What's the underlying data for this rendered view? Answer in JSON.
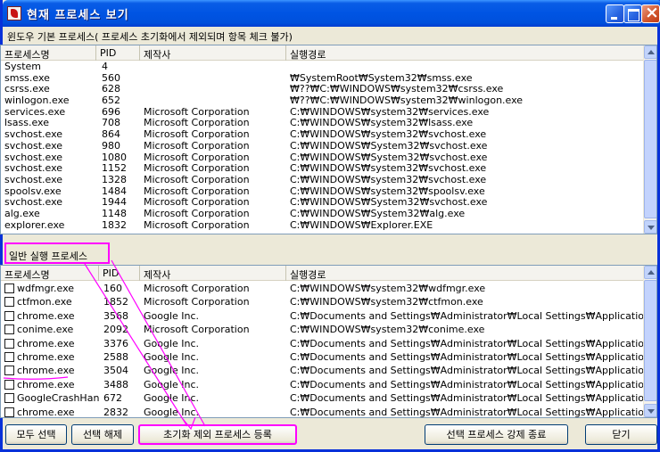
{
  "window": {
    "title": "현재 프로세스 보기"
  },
  "system_section": {
    "label": "윈도우 기본 프로세스( 프로세스 초기화에서 제외되며 항목 체크 불가)",
    "columns": [
      "프로세스명",
      "PID",
      "제작사",
      "실행경로"
    ],
    "rows": [
      [
        "System",
        "4",
        "",
        ""
      ],
      [
        "smss.exe",
        "560",
        "",
        "₩SystemRoot₩System32₩smss.exe"
      ],
      [
        "csrss.exe",
        "628",
        "",
        "₩??₩C:₩WINDOWS₩system32₩csrss.exe"
      ],
      [
        "winlogon.exe",
        "652",
        "",
        "₩??₩C:₩WINDOWS₩system32₩winlogon.exe"
      ],
      [
        "services.exe",
        "696",
        "Microsoft Corporation",
        "C:₩WINDOWS₩system32₩services.exe"
      ],
      [
        "lsass.exe",
        "708",
        "Microsoft Corporation",
        "C:₩WINDOWS₩system32₩lsass.exe"
      ],
      [
        "svchost.exe",
        "864",
        "Microsoft Corporation",
        "C:₩WINDOWS₩system32₩svchost.exe"
      ],
      [
        "svchost.exe",
        "980",
        "Microsoft Corporation",
        "C:₩WINDOWS₩System32₩svchost.exe"
      ],
      [
        "svchost.exe",
        "1080",
        "Microsoft Corporation",
        "C:₩WINDOWS₩System32₩svchost.exe"
      ],
      [
        "svchost.exe",
        "1152",
        "Microsoft Corporation",
        "C:₩WINDOWS₩system32₩svchost.exe"
      ],
      [
        "svchost.exe",
        "1328",
        "Microsoft Corporation",
        "C:₩WINDOWS₩system32₩svchost.exe"
      ],
      [
        "spoolsv.exe",
        "1484",
        "Microsoft Corporation",
        "C:₩WINDOWS₩system32₩spoolsv.exe"
      ],
      [
        "svchost.exe",
        "1944",
        "Microsoft Corporation",
        "C:₩WINDOWS₩System32₩svchost.exe"
      ],
      [
        "alg.exe",
        "1148",
        "Microsoft Corporation",
        "C:₩WINDOWS₩System32₩alg.exe"
      ],
      [
        "explorer.exe",
        "1832",
        "Microsoft Corporation",
        "C:₩WINDOWS₩Explorer.EXE"
      ]
    ]
  },
  "general_section": {
    "label": "일반 실행 프로세스",
    "columns": [
      "프로세스명",
      "PID",
      "제작사",
      "실행경로"
    ],
    "rows": [
      [
        "wdfmgr.exe",
        "160",
        "Microsoft Corporation",
        "C:₩WINDOWS₩system32₩wdfmgr.exe"
      ],
      [
        "ctfmon.exe",
        "1852",
        "Microsoft Corporation",
        "C:₩WINDOWS₩system32₩ctfmon.exe"
      ],
      [
        "chrome.exe",
        "3568",
        "Google Inc.",
        "C:₩Documents and Settings₩Administrator₩Local Settings₩Application Data₩..."
      ],
      [
        "conime.exe",
        "2092",
        "Microsoft Corporation",
        "C:₩WINDOWS₩system32₩conime.exe"
      ],
      [
        "chrome.exe",
        "3376",
        "Google Inc.",
        "C:₩Documents and Settings₩Administrator₩Local Settings₩Application Data₩..."
      ],
      [
        "chrome.exe",
        "2588",
        "Google Inc.",
        "C:₩Documents and Settings₩Administrator₩Local Settings₩Application Data₩..."
      ],
      [
        "chrome.exe",
        "3504",
        "Google Inc.",
        "C:₩Documents and Settings₩Administrator₩Local Settings₩Application Data₩..."
      ],
      [
        "chrome.exe",
        "3488",
        "Google Inc.",
        "C:₩Documents and Settings₩Administrator₩Local Settings₩Application Data₩..."
      ],
      [
        "GoogleCrashHand...",
        "672",
        "Google Inc.",
        "C:₩Documents and Settings₩Administrator₩Local Settings₩Application Data₩..."
      ],
      [
        "chrome.exe",
        "2832",
        "Google Inc.",
        "C:₩Documents and Settings₩Administrator₩Local Settings₩Application Data₩..."
      ]
    ]
  },
  "buttons": {
    "select_all": "모두 선택",
    "deselect": "선택 해제",
    "register_exclusion": "초기화 제외 프로세스 등록",
    "force_kill": "선택 프로세스 강제 종료",
    "close": "닫기"
  },
  "colors": {
    "title_bar": "#0054e3",
    "annotation": "#ff00ff",
    "window_face": "#ece9d8"
  }
}
